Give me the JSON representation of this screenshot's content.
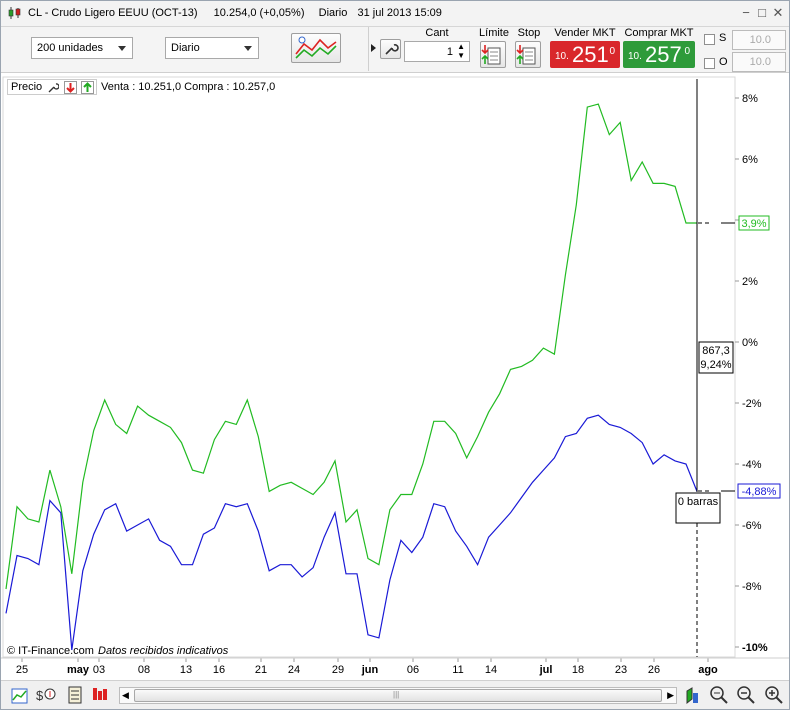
{
  "title_bar": {
    "title": "CL - Crudo Ligero EEUU (OCT-13)",
    "price": "10.254,0 (+0,05%)",
    "period": "Diario",
    "datetime": "31 jul 2013 15:09"
  },
  "toolbar": {
    "units_select": "200 unidades",
    "period_select": "Diario",
    "cant_label": "Cant",
    "cant_value": "1",
    "limit_label": "Límite",
    "stop_label": "Stop",
    "sell": {
      "label": "Vender MKT",
      "prefix": "10.",
      "big": "251",
      "decimal": "0"
    },
    "buy": {
      "label": "Comprar MKT",
      "prefix": "10.",
      "big": "257",
      "decimal": "0"
    },
    "s_label": "S",
    "o_label": "O",
    "s_value": "10.0",
    "o_value": "10.0",
    "sell_color": "#d9272b",
    "buy_color": "#2e9b3a"
  },
  "legend": {
    "price_label": "Precio",
    "quote": "Venta : 10.251,0 Compra : 10.257,0"
  },
  "chart_data": {
    "type": "line",
    "y_unit": "%",
    "yticks": [
      "8%",
      "6%",
      "4%",
      "2%",
      "0%",
      "-2%",
      "-4%",
      "-6%",
      "-8%",
      "-10%"
    ],
    "ylim": [
      -10,
      8
    ],
    "xticks": [
      "25",
      "may",
      "03",
      "08",
      "13",
      "16",
      "21",
      "24",
      "29",
      "jun",
      "06",
      "11",
      "14",
      "jul",
      "18",
      "23",
      "26",
      "ago"
    ],
    "series": [
      {
        "color": "#22bb22",
        "last_label": "3,9%",
        "values": [
          -8.1,
          -5.4,
          -5.8,
          -5.9,
          -4.2,
          -5.4,
          -7.6,
          -4.6,
          -2.9,
          -1.9,
          -2.7,
          -3.0,
          -2.1,
          -2.4,
          -2.6,
          -2.8,
          -3.3,
          -4.2,
          -4.3,
          -3.2,
          -2.6,
          -2.7,
          -1.9,
          -3.1,
          -4.9,
          -4.7,
          -4.6,
          -4.8,
          -5.0,
          -4.6,
          -3.9,
          -5.9,
          -5.5,
          -7.1,
          -7.3,
          -5.5,
          -5.0,
          -5.0,
          -4.0,
          -2.6,
          -2.6,
          -3.0,
          -3.8,
          -3.1,
          -2.3,
          -1.7,
          -0.9,
          -0.8,
          -0.6,
          -0.2,
          -0.4,
          2.2,
          4.5,
          7.7,
          7.8,
          6.8,
          7.2,
          5.3,
          5.9,
          5.2,
          5.2,
          5.1,
          3.9,
          3.9
        ]
      },
      {
        "color": "#1a1ad6",
        "last_label": "-4,88%",
        "values": [
          -8.9,
          -7.0,
          -7.1,
          -7.3,
          -5.2,
          -5.6,
          -10.1,
          -7.5,
          -6.3,
          -5.5,
          -5.3,
          -6.2,
          -6.0,
          -5.8,
          -6.5,
          -6.7,
          -7.3,
          -7.3,
          -6.3,
          -6.1,
          -5.3,
          -5.4,
          -5.3,
          -6.2,
          -7.5,
          -7.3,
          -7.3,
          -7.7,
          -7.4,
          -6.4,
          -5.6,
          -7.6,
          -7.6,
          -9.6,
          -9.7,
          -7.8,
          -6.5,
          -6.9,
          -6.4,
          -5.3,
          -5.4,
          -6.2,
          -6.7,
          -7.3,
          -6.4,
          -6.0,
          -5.6,
          -5.1,
          -4.6,
          -4.2,
          -3.8,
          -3.1,
          -3.0,
          -2.5,
          -2.4,
          -2.7,
          -2.8,
          -3.0,
          -3.3,
          -4.0,
          -3.7,
          -3.9,
          -4.0,
          -4.9
        ]
      }
    ],
    "cursor_labels": {
      "value": "867,3",
      "percent": "9,24%",
      "bars": "0 barras"
    }
  },
  "footer": {
    "copyright": "© IT-Finance.com",
    "note": "Datos recibidos indicativos"
  }
}
